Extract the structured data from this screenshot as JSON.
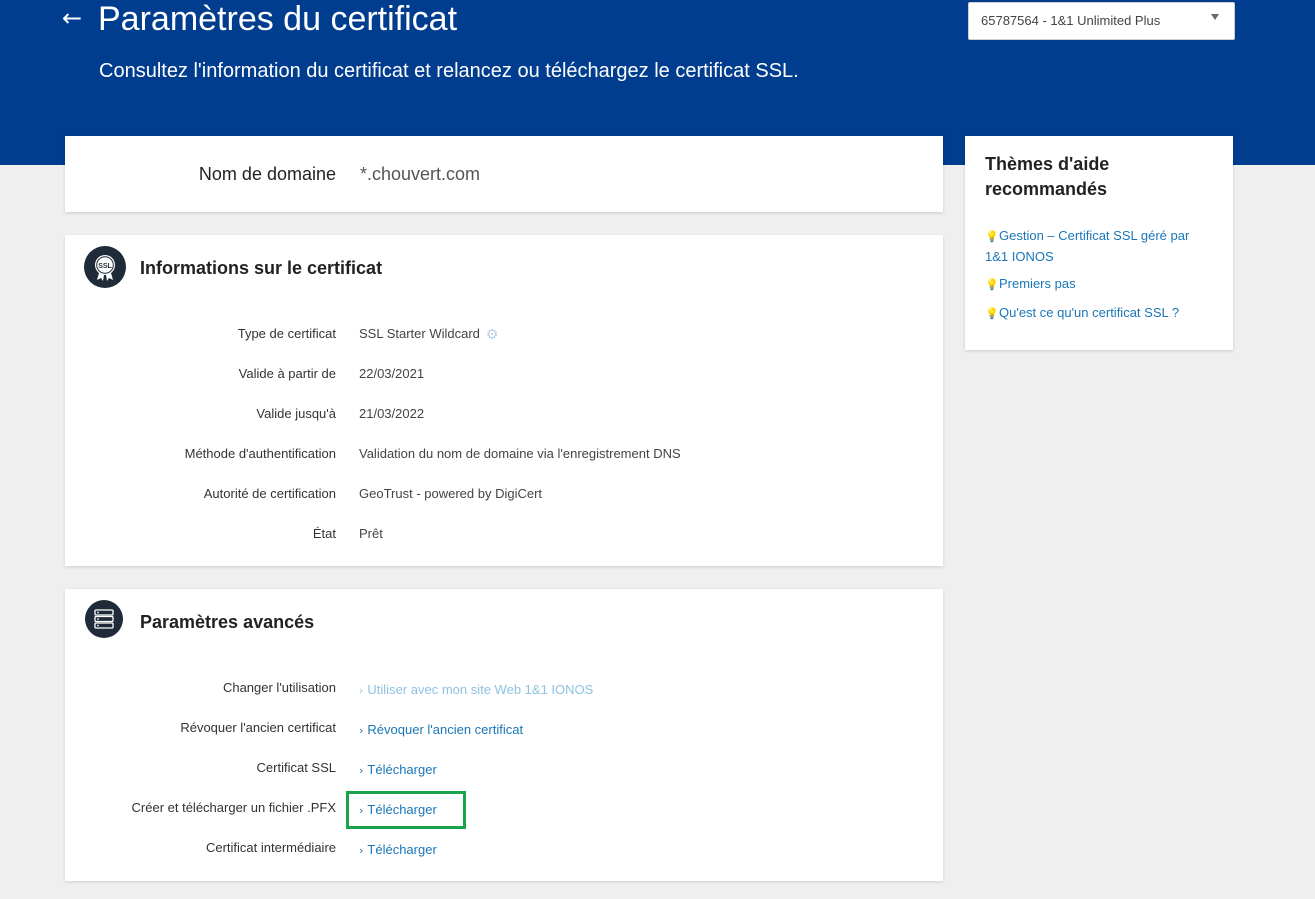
{
  "header": {
    "back_icon": "arrow-left-icon",
    "title": "Paramètres du certificat",
    "subtitle": "Consultez l'information du certificat et relancez ou téléchargez le certificat SSL.",
    "contract_selected": "65787564 - 1&1 Unlimited Plus",
    "background_color": "#003d8f"
  },
  "domain": {
    "label": "Nom de domaine",
    "value": "*.chouvert.com"
  },
  "certificate_info": {
    "title": "Informations sur le certificat",
    "icon": "ssl-badge-icon",
    "icon_text": "SSL",
    "rows": [
      {
        "label": "Type de certificat",
        "value": "SSL Starter Wildcard"
      },
      {
        "label": "Valide à partir de",
        "value": "22/03/2021"
      },
      {
        "label": "Valide jusqu'à",
        "value": "21/03/2022"
      },
      {
        "label": "Méthode d'authentification",
        "value": "Validation du nom de domaine via l'enregistrement DNS"
      },
      {
        "label": "Autorité de certification",
        "value": "GeoTrust - powered by DigiCert"
      },
      {
        "label": "État",
        "value": "Prêt"
      }
    ]
  },
  "advanced": {
    "title": "Paramètres avancés",
    "icon": "server-icon",
    "rows": [
      {
        "label": "Changer l'utilisation",
        "link": "Utiliser avec mon site Web 1&1 IONOS",
        "disabled": true
      },
      {
        "label": "Révoquer l'ancien certificat",
        "link": "Révoquer l'ancien certificat"
      },
      {
        "label": "Certificat SSL",
        "link": "Télécharger"
      },
      {
        "label": "Créer et télécharger un fichier .PFX",
        "link": "Télécharger",
        "highlighted": true
      },
      {
        "label": "Certificat intermédiaire",
        "link": "Télécharger"
      }
    ]
  },
  "help": {
    "title": "Thèmes d'aide recommandés",
    "links": [
      "Gestion – Certificat SSL géré par 1&1 IONOS",
      "Premiers pas",
      "Qu'est ce qu'un certificat SSL ?"
    ],
    "link_icon": "lightbulb-icon"
  },
  "colors": {
    "link": "#1a76b8",
    "link_disabled": "#8fc2e0",
    "highlight_border": "#1aa34a",
    "page_background": "#efefef"
  }
}
